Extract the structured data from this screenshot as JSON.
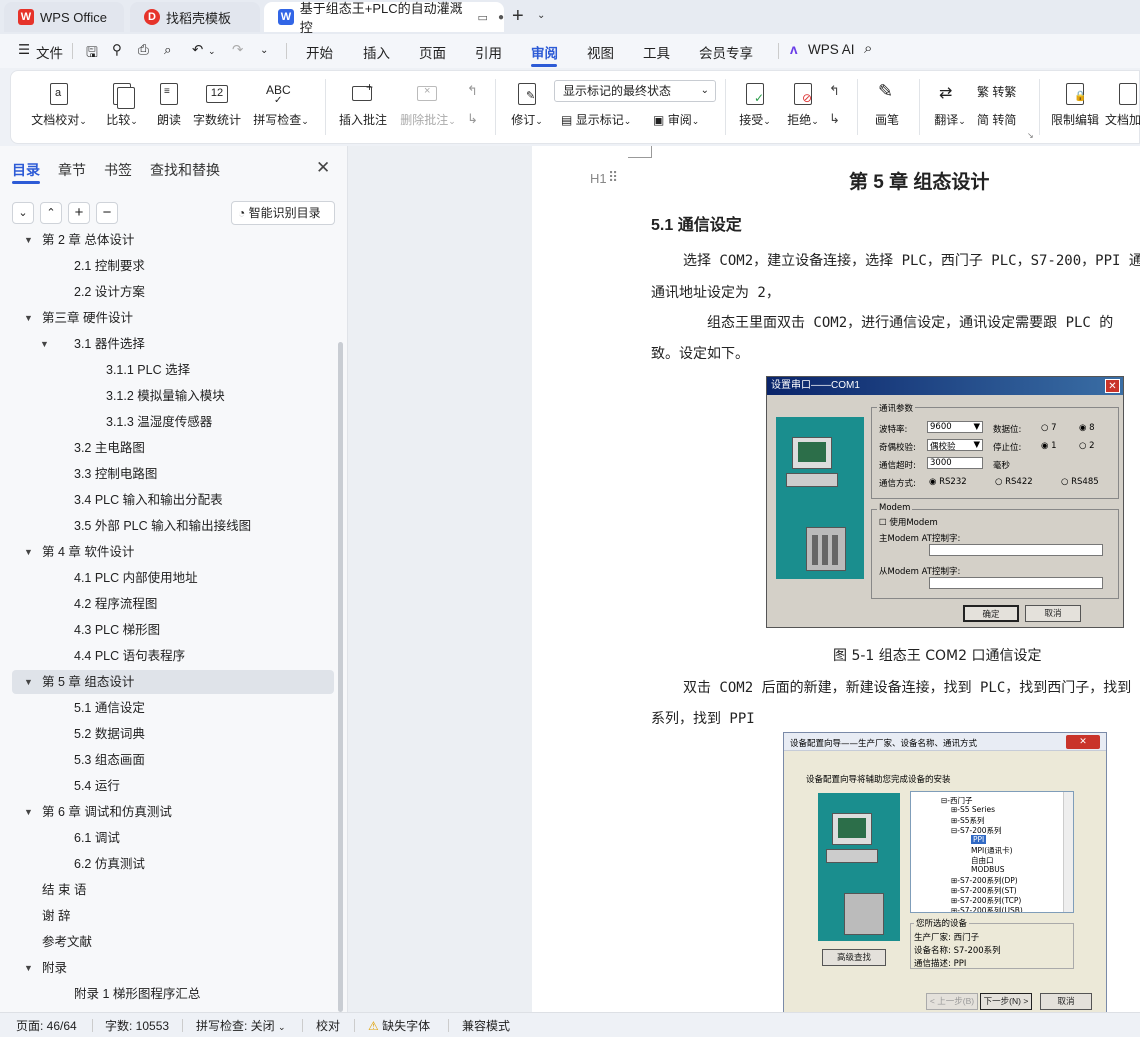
{
  "tabs": [
    {
      "label": "WPS Office"
    },
    {
      "label": "找稻壳模板"
    },
    {
      "label": "基于组态王+PLC的自动灌溉控"
    }
  ],
  "menu": {
    "file": "文件",
    "items": [
      "开始",
      "插入",
      "页面",
      "引用",
      "审阅",
      "视图",
      "工具",
      "会员专享"
    ],
    "active": "审阅",
    "ai": "WPS AI"
  },
  "ribbon": {
    "doc_proof": "文档校对",
    "compare": "比较",
    "read": "朗读",
    "word_count": "字数统计",
    "spell_check": "拼写检查",
    "insert_comment": "插入批注",
    "delete_comment": "删除批注",
    "track": "修订",
    "markup_select": "显示标记的最终状态",
    "show_markup": "显示标记",
    "review": "审阅",
    "accept": "接受",
    "reject": "拒绝",
    "pen": "画笔",
    "translate": "翻译",
    "to_trad": "转繁",
    "to_simp": "转简",
    "restrict": "限制编辑",
    "doc_more": "文档加",
    "abc": "ABC",
    "num12": "12"
  },
  "nav": {
    "tabs": [
      "目录",
      "章节",
      "书签",
      "查找和替换"
    ],
    "smart_toc": "智能识别目录",
    "items": [
      {
        "label": "第 2 章  总体设计",
        "level": 0,
        "expand": "▼"
      },
      {
        "label": "2.1  控制要求",
        "level": 1,
        "expand": ""
      },
      {
        "label": "2.2    设计方案",
        "level": 1,
        "expand": ""
      },
      {
        "label": "第三章  硬件设计",
        "level": 0,
        "expand": "▼"
      },
      {
        "label": "3.1 器件选择",
        "level": 1,
        "expand": "▼"
      },
      {
        "label": "3.1.1 PLC 选择",
        "level": 2,
        "expand": ""
      },
      {
        "label": "3.1.2  模拟量输入模块",
        "level": 2,
        "expand": ""
      },
      {
        "label": "3.1.3  温湿度传感器",
        "level": 2,
        "expand": ""
      },
      {
        "label": "3.2 主电路图",
        "level": 1,
        "expand": ""
      },
      {
        "label": "3.3 控制电路图",
        "level": 1,
        "expand": ""
      },
      {
        "label": "3.4 PLC 输入和输出分配表",
        "level": 1,
        "expand": ""
      },
      {
        "label": "3.5  外部 PLC 输入和输出接线图",
        "level": 1,
        "expand": ""
      },
      {
        "label": "第 4 章  软件设计",
        "level": 0,
        "expand": "▼"
      },
      {
        "label": "4.1 PLC 内部使用地址",
        "level": 1,
        "expand": ""
      },
      {
        "label": "4.2  程序流程图",
        "level": 1,
        "expand": ""
      },
      {
        "label": "4.3 PLC 梯形图",
        "level": 1,
        "expand": ""
      },
      {
        "label": "4.4 PLC 语句表程序",
        "level": 1,
        "expand": ""
      },
      {
        "label": "第 5 章  组态设计",
        "level": 0,
        "expand": "▼"
      },
      {
        "label": "5.1  通信设定",
        "level": 1,
        "expand": ""
      },
      {
        "label": "5.2 数据词典",
        "level": 1,
        "expand": ""
      },
      {
        "label": "5.3 组态画面",
        "level": 1,
        "expand": ""
      },
      {
        "label": "5.4 运行",
        "level": 1,
        "expand": ""
      },
      {
        "label": "第 6 章  调试和仿真测试",
        "level": 0,
        "expand": "▼"
      },
      {
        "label": "6.1  调试",
        "level": 1,
        "expand": ""
      },
      {
        "label": "6.2  仿真测试",
        "level": 1,
        "expand": ""
      },
      {
        "label": "结  束  语",
        "level": 0,
        "expand": ""
      },
      {
        "label": "谢  辞",
        "level": 0,
        "expand": ""
      },
      {
        "label": "参考文献",
        "level": 0,
        "expand": ""
      },
      {
        "label": "附录",
        "level": 0,
        "expand": "▼"
      },
      {
        "label": "附录 1  梯形图程序汇总",
        "level": 1,
        "expand": ""
      }
    ],
    "selected_index": 17
  },
  "doc": {
    "heading_marker": "H1",
    "chapter_title": "第 5 章  组态设计",
    "section_title": "5.1 通信设定",
    "para1_line1": "选择 COM2，建立设备连接，选择 PLC，西门子 PLC，S7-200，PPI 通",
    "para1_line2": "通讯地址设定为 2，",
    "para2_line1": "组态王里面双击 COM2，进行通信设定，通讯设定需要跟 PLC 的",
    "para2_line2": "致。设定如下。",
    "fig1_caption": "图 5-1 组态王 COM2 口通信设定",
    "para3_line1": "双击 COM2 后面的新建，新建设备连接，找到 PLC，找到西门子，找到",
    "para3_line2": "系列，找到 PPI"
  },
  "dialog1": {
    "title": "设置串口——COM1",
    "group": "通讯参数",
    "baud_label": "波特率:",
    "baud_value": "9600",
    "databits_label": "数据位:",
    "db7": "7",
    "db8": "8",
    "parity_label": "奇偶校验:",
    "parity_value": "偶校验",
    "stopbits_label": "停止位:",
    "sb1": "1",
    "sb2": "2",
    "timeout_label": "通信超时:",
    "timeout_value": "3000",
    "timeout_unit": "毫秒",
    "mode_label": "通信方式:",
    "rs232": "RS232",
    "rs422": "RS422",
    "rs485": "RS485",
    "modem_group": "Modem",
    "use_modem": "使用Modem",
    "master_at": "主Modem AT控制字:",
    "slave_at": "从Modem AT控制字:",
    "ok": "确定",
    "cancel": "取消"
  },
  "dialog2": {
    "title": "设备配置向导——生产厂家、设备名称、通讯方式",
    "intro": "设备配置向导将辅助您完成设备的安装",
    "tree": [
      {
        "t": "⊟-西门子",
        "indent": 0
      },
      {
        "t": "⊞-S5 Series",
        "indent": 1
      },
      {
        "t": "⊞-S5系列",
        "indent": 1
      },
      {
        "t": "⊟-S7-200系列",
        "indent": 1
      },
      {
        "t": "PPI",
        "indent": 3
      },
      {
        "t": "MPI(通讯卡)",
        "indent": 3
      },
      {
        "t": "自由口",
        "indent": 3
      },
      {
        "t": "MODBUS",
        "indent": 3
      },
      {
        "t": "⊞-S7-200系列(DP)",
        "indent": 1
      },
      {
        "t": "⊞-S7-200系列(ST)",
        "indent": 1
      },
      {
        "t": "⊞-S7-200系列(TCP)",
        "indent": 1
      },
      {
        "t": "⊞-S7-200系列(USB)",
        "indent": 1
      }
    ],
    "selected_group": "您所选的设备",
    "maker_label": "生产厂家:",
    "maker_value": "西门子",
    "device_label": "设备名称:",
    "device_value": "S7-200系列",
    "comm_label": "通信描述:",
    "comm_value": "PPI",
    "advanced": "高级查找",
    "prev": "< 上一步(B)",
    "next": "下一步(N) >",
    "cancel": "取消"
  },
  "status": {
    "page": "页面: 46/64",
    "words": "字数: 10553",
    "spell": "拼写检查: 关闭",
    "proof": "校对",
    "missing_font": "缺失字体",
    "compat": "兼容模式"
  },
  "colors": {
    "accent": "#2d5bd6",
    "wps_red": "#e6332a",
    "doc_blue": "#3266e6"
  }
}
